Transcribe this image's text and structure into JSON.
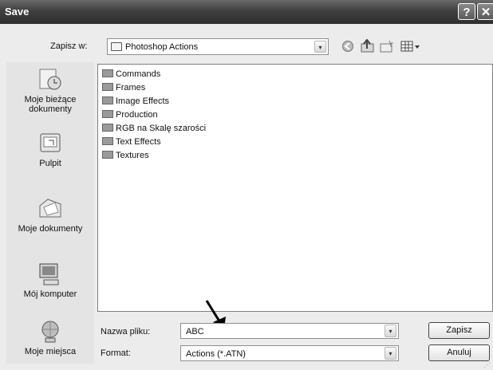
{
  "window": {
    "title": "Save",
    "help_glyph": "?",
    "close_glyph": "✕"
  },
  "location": {
    "label": "Zapisz w:",
    "value": "Photoshop Actions",
    "dropdown_glyph": "▾"
  },
  "toolbar": {
    "icons": [
      "back-icon",
      "up-folder-icon",
      "new-folder-icon",
      "views-menu-icon"
    ]
  },
  "places": [
    {
      "label": "Moje bieżące dokumenty",
      "icon": "recent-documents-icon"
    },
    {
      "label": "Pulpit",
      "icon": "desktop-icon"
    },
    {
      "label": "Moje dokumenty",
      "icon": "my-documents-icon"
    },
    {
      "label": "Mój komputer",
      "icon": "my-computer-icon"
    },
    {
      "label": "Moje miejsca",
      "icon": "network-places-icon"
    }
  ],
  "files": [
    "Commands",
    "Frames",
    "Image Effects",
    "Production",
    "RGB na Skalę szarości",
    "Text Effects",
    "Textures"
  ],
  "filename": {
    "label": "Nazwa pliku:",
    "value": "ABC",
    "dropdown_glyph": "▾"
  },
  "format": {
    "label": "Format:",
    "value": "Actions (*.ATN)",
    "dropdown_glyph": "▾"
  },
  "buttons": {
    "save": "Zapisz",
    "cancel": "Anuluj"
  }
}
